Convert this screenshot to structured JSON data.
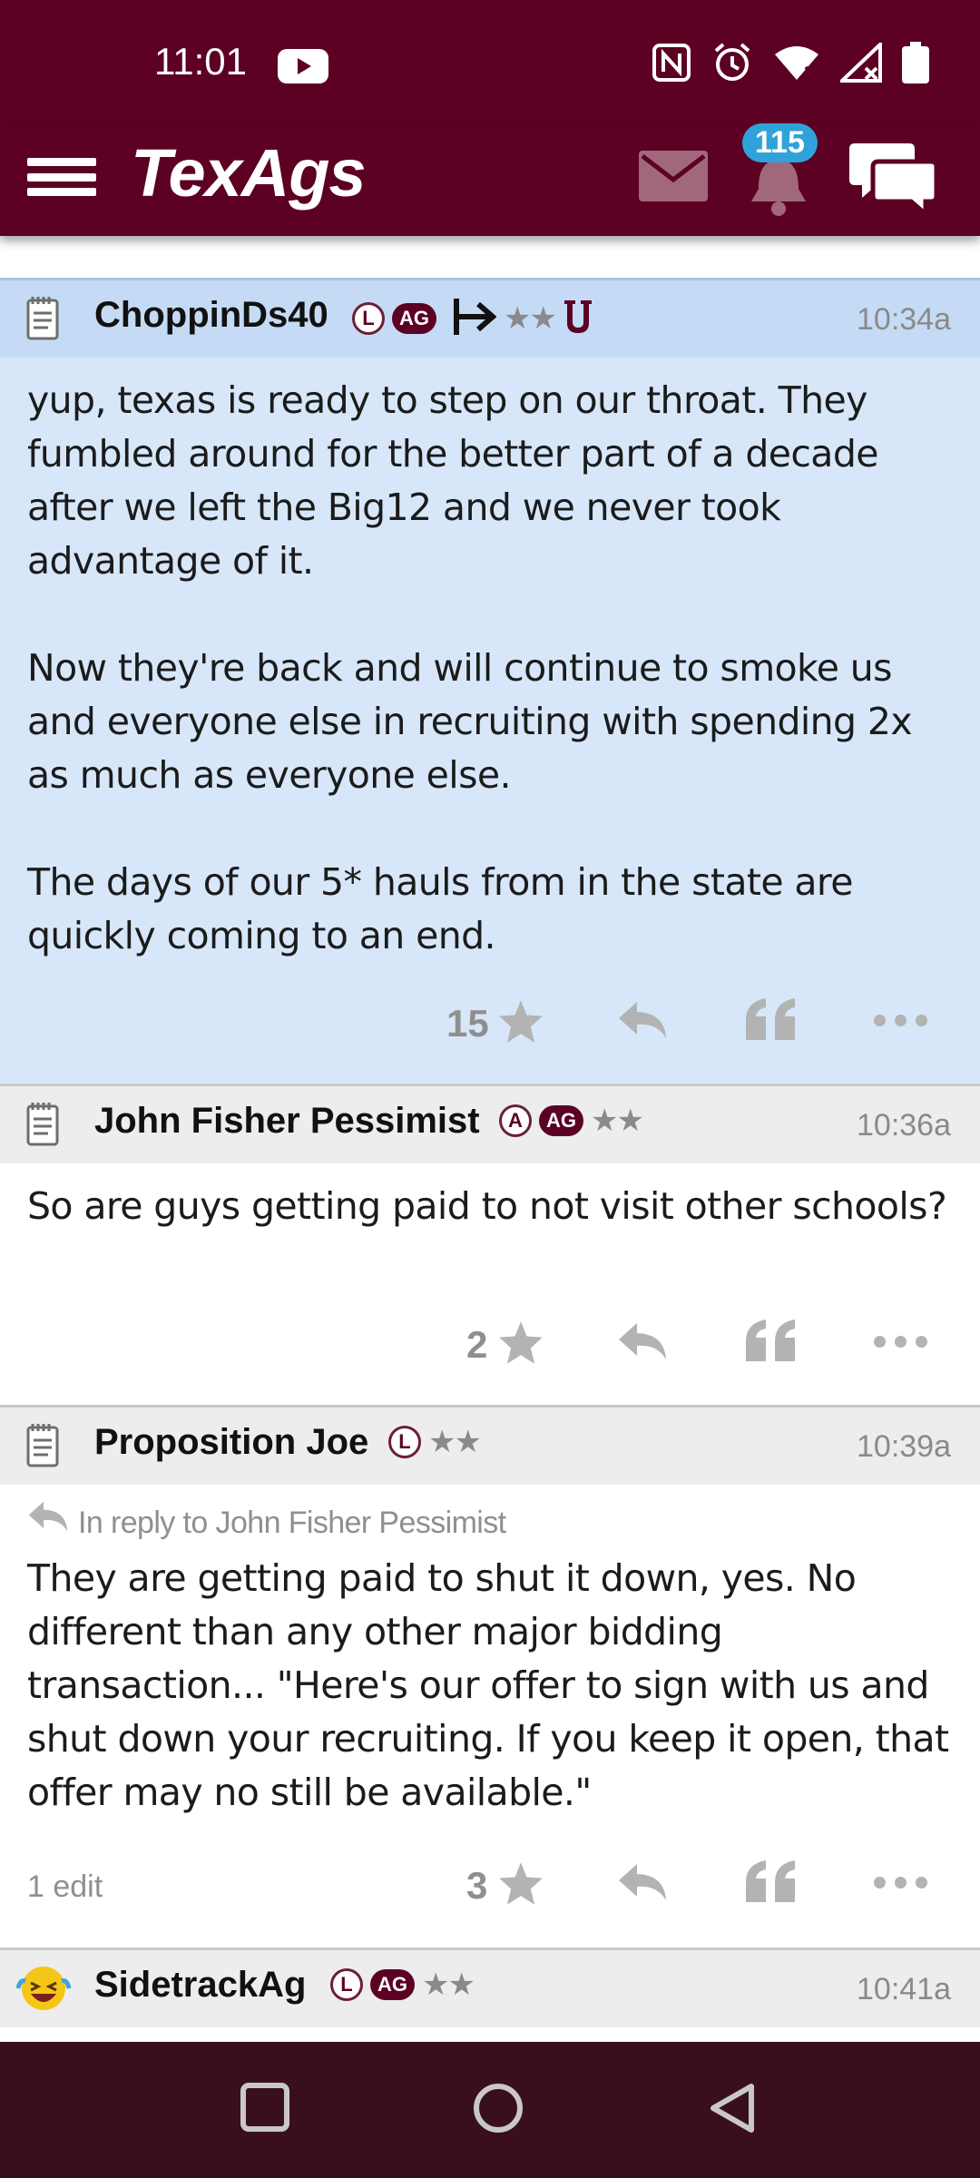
{
  "status_bar": {
    "time": "11:01"
  },
  "header": {
    "logo_text": "TexAgs",
    "notification_count": "115"
  },
  "colors": {
    "brand_maroon": "#5c0024",
    "highlight_blue": "#d7e7f9",
    "highlight_head_blue": "#c5dbf5",
    "head_gray": "#ededed",
    "badge_blue": "#2fa3d9",
    "nav_bar": "#3a0f1c"
  },
  "posts": [
    {
      "username": "ChoppinDs40",
      "badges": [
        "L",
        "AG"
      ],
      "stars": "★★",
      "extra_icons": [
        "arrow-bar-icon",
        "longhorn-u-icon"
      ],
      "time": "10:34a",
      "paragraphs": [
        "yup, texas is ready to step on our throat. They fumbled around for the better part of a decade after we left the Big12 and we never took advantage of it.",
        "Now they're back and will continue to smoke us and everyone else in recruiting with spending 2x as much as everyone else.",
        "The days of our 5* hauls from in the state are quickly coming to an end."
      ],
      "likes": "15"
    },
    {
      "username": "John Fisher Pessimist",
      "badges": [
        "A",
        "AG"
      ],
      "stars": "★★",
      "time": "10:36a",
      "paragraphs": [
        "So are guys getting paid to not visit other schools?"
      ],
      "likes": "2"
    },
    {
      "username": "Proposition Joe",
      "badges": [
        "L"
      ],
      "stars": "★★",
      "time": "10:39a",
      "reply_to": "In reply to John Fisher Pessimist",
      "paragraphs": [
        "They are getting paid to shut it down, yes. No different than any other major bidding transaction... \"Here's our offer to sign with us and shut down your recruiting. If you keep it open, that offer may no still be available.\""
      ],
      "likes": "3",
      "edit_note": "1 edit"
    },
    {
      "username": "SidetrackAg",
      "badges": [
        "L",
        "AG"
      ],
      "stars": "★★",
      "time": "10:41a"
    }
  ]
}
